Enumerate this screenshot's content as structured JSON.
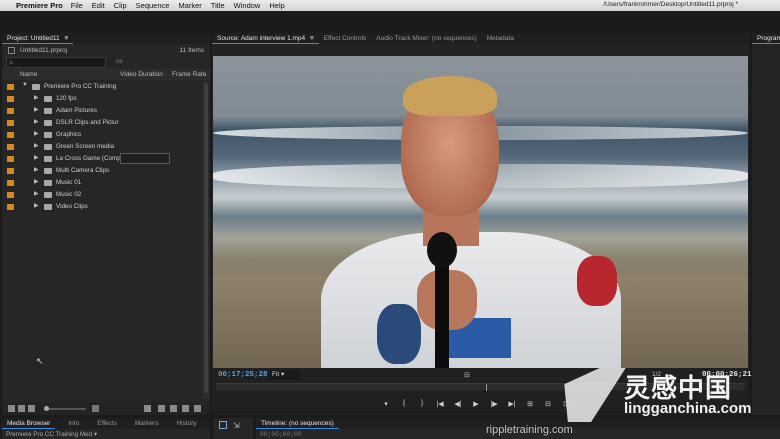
{
  "menubar": {
    "app": "Premiere Pro",
    "items": [
      "File",
      "Edit",
      "Clip",
      "Sequence",
      "Marker",
      "Title",
      "Window",
      "Help"
    ],
    "path": "/Users/frankrohmer/Desktop/Untitled11.prproj *"
  },
  "project": {
    "tab": "Project: Untitled11",
    "file": "Untitled11.prproj",
    "count": "11 Items",
    "columns": [
      "Name",
      "Video Duration",
      "Frame Rate"
    ],
    "rows": [
      {
        "label": "Premiere Pro CC Training",
        "level": 0,
        "open": true
      },
      {
        "label": "120 fps",
        "level": 1
      },
      {
        "label": "Adam Pictures",
        "level": 1
      },
      {
        "label": "DSLR Clips and Pictur",
        "level": 1
      },
      {
        "label": "Graphics",
        "level": 1
      },
      {
        "label": "Green Screen media",
        "level": 1
      },
      {
        "label": "La Cross Game (Comp",
        "level": 1,
        "editing": true
      },
      {
        "label": "Multi Camera Clips",
        "level": 1
      },
      {
        "label": "Music 01",
        "level": 1
      },
      {
        "label": "Music 02",
        "level": 1
      },
      {
        "label": "Video Clips",
        "level": 1
      }
    ]
  },
  "source": {
    "tabs": [
      "Source: Adam interview 1.mp4",
      "Effect Controls",
      "Audio Track Mixer: (no sequences)",
      "Metadata"
    ],
    "timecode": "00;17;25;28",
    "fit": "Fit",
    "quality": "1/2",
    "duration": "00;00;26;21",
    "transport": [
      "▾",
      "{",
      "}",
      "|◀",
      "◀|",
      "▶",
      "|▶",
      "▶|",
      "⊞",
      "⊟",
      "⊡"
    ]
  },
  "program": {
    "tab": "Program"
  },
  "bottom": {
    "left_tabs": [
      "Media Browser",
      "Info",
      "Effects",
      "Markers",
      "History"
    ],
    "left_item": "Premiere Pro CC Training Med ▾",
    "timeline_tab": "Timeline: (no sequences)",
    "timeline_tc": "00;00;00;00"
  },
  "watermark": {
    "cn": "灵感中国",
    "site": "lingganchina.com",
    "ripple": "rippletraining.com"
  },
  "colors": {
    "accent": "#3a8ddc",
    "label_orange": "#d68a1d",
    "timecode": "#4aa3e8"
  }
}
